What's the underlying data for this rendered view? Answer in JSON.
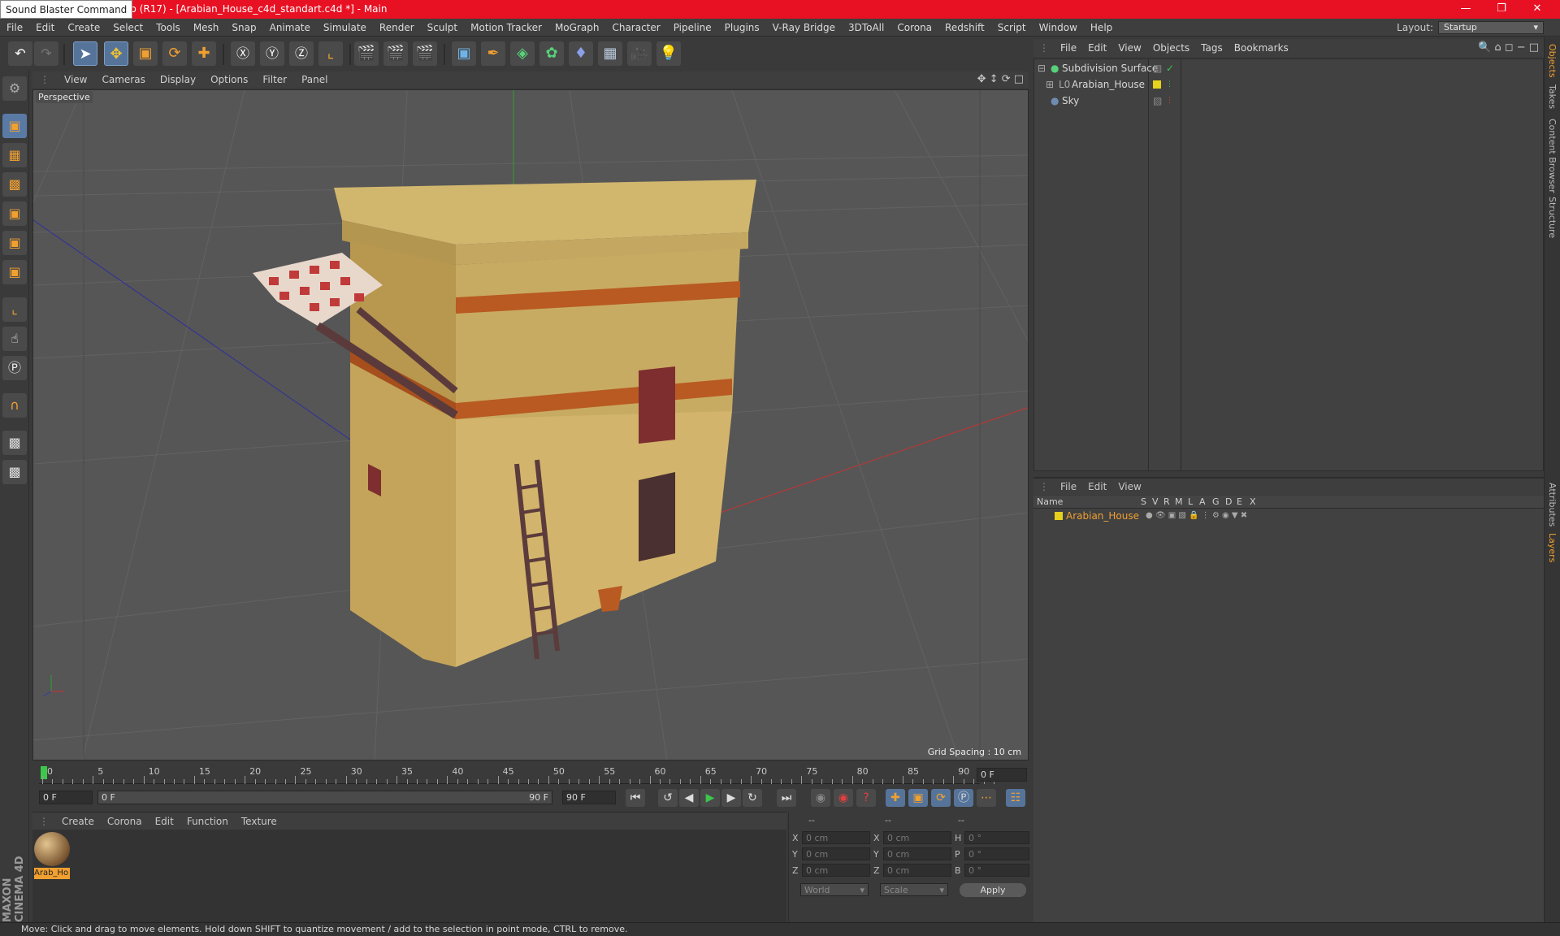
{
  "titlebar": {
    "tooltip": "Sound Blaster Command",
    "title": "udio (R17) - [Arabian_House_c4d_standart.c4d *] - Main"
  },
  "menubar": {
    "items": [
      "File",
      "Edit",
      "Create",
      "Select",
      "Tools",
      "Mesh",
      "Snap",
      "Animate",
      "Simulate",
      "Render",
      "Sculpt",
      "Motion Tracker",
      "MoGraph",
      "Character",
      "Pipeline",
      "Plugins",
      "V-Ray Bridge",
      "3DToAll",
      "Corona",
      "Redshift",
      "Script",
      "Window",
      "Help"
    ],
    "layout_label": "Layout:",
    "layout_value": "Startup"
  },
  "viewport": {
    "menu": [
      "View",
      "Cameras",
      "Display",
      "Options",
      "Filter",
      "Panel"
    ],
    "label": "Perspective",
    "grid_spacing": "Grid Spacing : 10 cm"
  },
  "timeline": {
    "ticks": [
      "0",
      "5",
      "10",
      "15",
      "20",
      "25",
      "30",
      "35",
      "40",
      "45",
      "50",
      "55",
      "60",
      "65",
      "70",
      "75",
      "80",
      "85",
      "90"
    ],
    "current_frame": "0 F",
    "start_field": "0 F",
    "slider_start": "0 F",
    "slider_end": "90 F",
    "end_field": "90 F"
  },
  "materials": {
    "menu": [
      "Create",
      "Corona",
      "Edit",
      "Function",
      "Texture"
    ],
    "items": [
      {
        "label": "Arab_Ho"
      }
    ]
  },
  "coords": {
    "header": [
      "--",
      "--",
      "--"
    ],
    "rows": [
      {
        "a": "X",
        "av": "0 cm",
        "b": "X",
        "bv": "0 cm",
        "c": "H",
        "cv": "0 °"
      },
      {
        "a": "Y",
        "av": "0 cm",
        "b": "Y",
        "bv": "0 cm",
        "c": "P",
        "cv": "0 °"
      },
      {
        "a": "Z",
        "av": "0 cm",
        "b": "Z",
        "bv": "0 cm",
        "c": "B",
        "cv": "0 °"
      }
    ],
    "world": "World",
    "scale": "Scale",
    "apply": "Apply"
  },
  "objects_panel": {
    "menu": [
      "File",
      "Edit",
      "View",
      "Objects",
      "Tags",
      "Bookmarks"
    ],
    "rows": [
      {
        "name": "Subdivision Surface",
        "color": "#4aa84a"
      },
      {
        "name": "Arabian_House",
        "color": "#e6d21c"
      },
      {
        "name": "Sky",
        "color": "#6f8cb0"
      }
    ]
  },
  "layers_panel": {
    "menu": [
      "File",
      "Edit",
      "View"
    ],
    "columns": [
      "Name",
      "S",
      "V",
      "R",
      "M",
      "L",
      "A",
      "G",
      "D",
      "E",
      "X"
    ],
    "rows": [
      {
        "name": "Arabian_House",
        "color": "#e6d21c"
      }
    ]
  },
  "side_tabs": [
    "Objects",
    "Takes",
    "Content Browser",
    "Structure",
    "Attributes",
    "Layers"
  ],
  "brand": "MAXON CINEMA 4D",
  "statusbar": "Move: Click and drag to move elements. Hold down SHIFT to quantize movement / add to the selection in point mode, CTRL to remove.",
  "colors": {
    "accent": "#e81123",
    "selection": "#f0a030",
    "layer": "#e6d21c"
  }
}
